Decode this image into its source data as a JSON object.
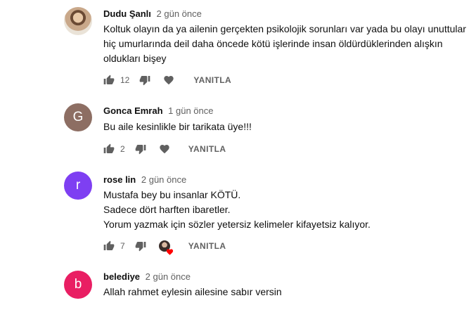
{
  "comments": [
    {
      "author": "Dudu Şanlı",
      "time": "2 gün önce",
      "avatar_letter": "",
      "avatar_color": "",
      "lines": [
        "Koltuk olayın da ya ailenin gerçekten psikolojik sorunları var yada bu olayı unuttular",
        "hiç umurlarında deil daha öncede kötü işlerinde insan öldürdüklerinden alışkın",
        "oldukları bişey"
      ],
      "likes": "12",
      "reply_label": "YANITLA"
    },
    {
      "author": "Gonca Emrah",
      "time": "1 gün önce",
      "avatar_letter": "G",
      "avatar_color": "#8d6e63",
      "lines": [
        "Bu aile kesinlikle bir tarikata üye!!!"
      ],
      "likes": "2",
      "reply_label": "YANITLA"
    },
    {
      "author": "rose lin",
      "time": "2 gün önce",
      "avatar_letter": "r",
      "avatar_color": "#7e3ff2",
      "lines": [
        "Mustafa bey bu insanlar KÖTÜ.",
        "Sadece dört harften ibaretler.",
        "Yorum yazmak için sözler yetersiz kelimeler kifayetsiz kalıyor."
      ],
      "likes": "7",
      "reply_label": "YANITLA",
      "creator_heart": true
    },
    {
      "author": "belediye",
      "time": "2 gün önce",
      "avatar_letter": "b",
      "avatar_color": "#e91e63",
      "lines": [
        "Allah rahmet eylesin ailesine sabır versin"
      ]
    }
  ],
  "icons": {
    "like": "thumb-up-icon",
    "dislike": "thumb-down-icon",
    "heart": "heart-icon"
  },
  "colors": {
    "heart": "#ff0000",
    "secondary_text": "#606060"
  }
}
